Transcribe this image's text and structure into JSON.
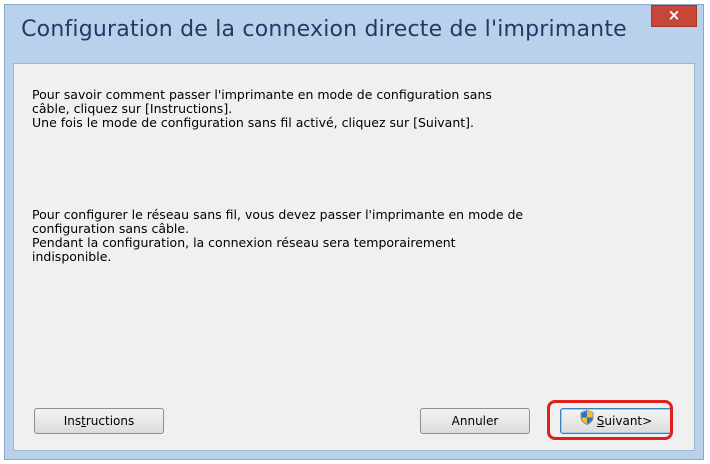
{
  "window": {
    "title": "Configuration de la connexion directe de l'imprimante",
    "close_symbol": "×"
  },
  "content": {
    "paragraph1": [
      "Pour savoir comment passer l'imprimante en mode de configuration sans",
      "câble, cliquez sur [Instructions].",
      "Une fois le mode de configuration sans fil activé, cliquez sur [Suivant]."
    ],
    "paragraph2": [
      "Pour configurer le réseau sans fil, vous devez passer l'imprimante en mode de",
      "configuration sans câble.",
      "Pendant la configuration, la connexion réseau sera temporairement",
      "indisponible."
    ]
  },
  "buttons": {
    "instructions": {
      "pre": "Ins",
      "accel": "t",
      "post": "ructions"
    },
    "cancel": "Annuler",
    "next": {
      "accel": "S",
      "post": "uivant>"
    }
  },
  "colors": {
    "frame": "#b9d1ea",
    "title_text": "#1e3c64",
    "close_button": "#c7463a",
    "client_bg": "#f0f0f0",
    "highlight": "#e0201c"
  },
  "icons": {
    "next_button_icon": "uac-shield-icon"
  }
}
